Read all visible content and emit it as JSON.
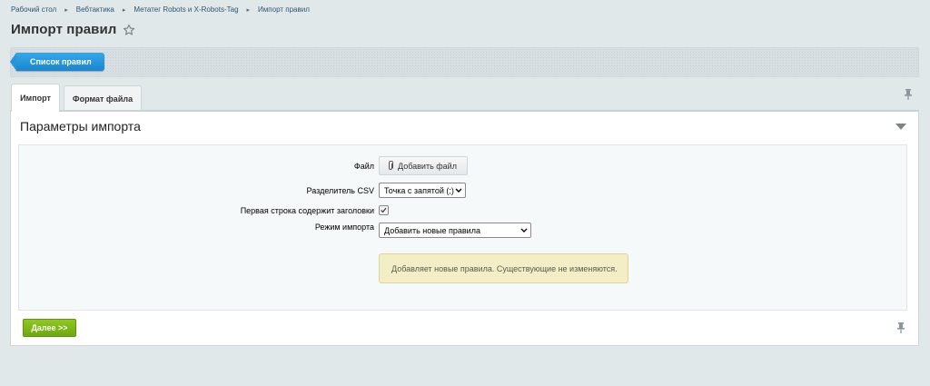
{
  "breadcrumb": {
    "items": [
      "Рабочий стол",
      "Вебтактика",
      "Метатег Robots и X-Robots-Tag",
      "Импорт правил"
    ]
  },
  "page": {
    "title": "Импорт правил"
  },
  "toolbar": {
    "list_button": "Список правил"
  },
  "tabs": [
    {
      "label": "Импорт",
      "active": true
    },
    {
      "label": "Формат файла",
      "active": false
    }
  ],
  "section": {
    "title": "Параметры импорта"
  },
  "form": {
    "file_label": "Файл",
    "file_button": "Добавить файл",
    "separator_label": "Разделитель CSV",
    "separator_value": "Точка с запятой (;)",
    "header_label": "Первая строка содержит заголовки",
    "header_checked": true,
    "mode_label": "Режим импорта",
    "mode_value": "Добавить новые правила",
    "hint": "Добавляет новые правила. Существующие не изменяются."
  },
  "footer": {
    "next_button": "Далее >>"
  },
  "colors": {
    "accent_blue": "#1a86cf",
    "next_green": "#7ab514",
    "hint_bg": "#f3eec5"
  },
  "icons": [
    "star-icon",
    "pin-icon",
    "collapse-arrow-icon",
    "paperclip-icon",
    "chevron-down-icon",
    "checkmark-icon"
  ]
}
